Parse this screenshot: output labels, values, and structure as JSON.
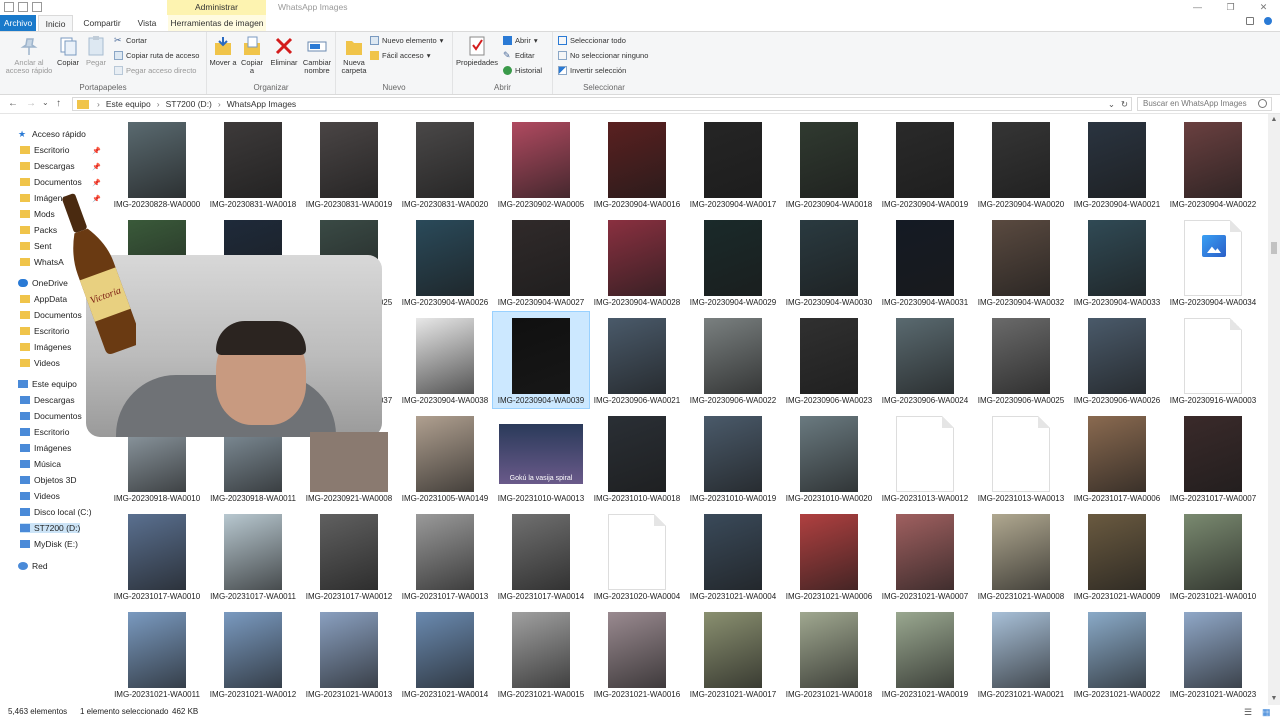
{
  "window": {
    "context_tab": "Administrar",
    "title": "WhatsApp Images"
  },
  "tabs": {
    "archivo": "Archivo",
    "inicio": "Inicio",
    "compartir": "Compartir",
    "vista": "Vista",
    "herramientas": "Herramientas de imagen"
  },
  "ribbon": {
    "portapapeles": {
      "label": "Portapapeles",
      "anclar": "Anclar al acceso rápido",
      "copiar": "Copiar",
      "pegar": "Pegar",
      "cortar": "Cortar",
      "copiar_ruta": "Copiar ruta de acceso",
      "pegar_acceso": "Pegar acceso directo"
    },
    "organizar": {
      "label": "Organizar",
      "mover": "Mover a",
      "copiar": "Copiar a",
      "eliminar": "Eliminar",
      "cambiar": "Cambiar nombre"
    },
    "nuevo": {
      "label": "Nuevo",
      "nueva_carpeta": "Nueva carpeta",
      "nuevo_elemento": "Nuevo elemento",
      "facil_acceso": "Fácil acceso"
    },
    "abrir": {
      "label": "Abrir",
      "propiedades": "Propiedades",
      "abrir": "Abrir",
      "editar": "Editar",
      "historial": "Historial"
    },
    "seleccionar": {
      "label": "Seleccionar",
      "todo": "Seleccionar todo",
      "ninguno": "No seleccionar ninguno",
      "invertir": "Invertir selección"
    }
  },
  "address": {
    "crumbs": [
      "Este equipo",
      "ST7200 (D:)",
      "WhatsApp Images"
    ],
    "search_placeholder": "Buscar en WhatsApp Images"
  },
  "navpane": {
    "quick_access": "Acceso rápido",
    "quick_items": [
      "Escritorio",
      "Descargas",
      "Documentos",
      "Imágenes",
      "Mods",
      "Packs",
      "Sent",
      "WhatsA"
    ],
    "onedrive": "OneDrive",
    "onedrive_items": [
      "AppData",
      "Documentos",
      "Escritorio",
      "Imágenes",
      "Videos"
    ],
    "this_pc": "Este equipo",
    "pc_items": [
      "Descargas",
      "Documentos",
      "Escritorio",
      "Imágenes",
      "Música",
      "Objetos 3D",
      "Videos",
      "Disco local (C:)",
      "ST7200 (D:)",
      "MyDisk (E:)"
    ],
    "network": "Red"
  },
  "files": [
    [
      "IMG-20230828-WA0000",
      "IMG-20230831-WA0018",
      "IMG-20230831-WA0019",
      "IMG-20230831-WA0020",
      "IMG-20230902-WA0005",
      "IMG-20230904-WA0016",
      "IMG-20230904-WA0017",
      "IMG-20230904-WA0018",
      "IMG-20230904-WA0019",
      "IMG-20230904-WA0020",
      "IMG-20230904-WA0021",
      "IMG-20230904-WA0022"
    ],
    [
      "",
      "",
      "IMG-20230904-WA0025",
      "IMG-20230904-WA0026",
      "IMG-20230904-WA0027",
      "IMG-20230904-WA0028",
      "IMG-20230904-WA0029",
      "IMG-20230904-WA0030",
      "IMG-20230904-WA0031",
      "IMG-20230904-WA0032",
      "IMG-20230904-WA0033",
      "IMG-20230904-WA0034"
    ],
    [
      "",
      "",
      "IMG-20230904-WA0037",
      "IMG-20230904-WA0038",
      "IMG-20230904-WA0039",
      "IMG-20230906-WA0021",
      "IMG-20230906-WA0022",
      "IMG-20230906-WA0023",
      "IMG-20230906-WA0024",
      "IMG-20230906-WA0025",
      "IMG-20230906-WA0026",
      "IMG-20230916-WA0003"
    ],
    [
      "IMG-20230918-WA0010",
      "IMG-20230918-WA0011",
      "IMG-20230921-WA0008",
      "IMG-20231005-WA0149",
      "IMG-20231010-WA0013",
      "IMG-20231010-WA0018",
      "IMG-20231010-WA0019",
      "IMG-20231010-WA0020",
      "IMG-20231013-WA0012",
      "IMG-20231013-WA0013",
      "IMG-20231017-WA0006",
      "IMG-20231017-WA0007"
    ],
    [
      "IMG-20231017-WA0010",
      "IMG-20231017-WA0011",
      "IMG-20231017-WA0012",
      "IMG-20231017-WA0013",
      "IMG-20231017-WA0014",
      "IMG-20231020-WA0004",
      "IMG-20231021-WA0004",
      "IMG-20231021-WA0006",
      "IMG-20231021-WA0007",
      "IMG-20231021-WA0008",
      "IMG-20231021-WA0009",
      "IMG-20231021-WA0010"
    ],
    [
      "IMG-20231021-WA0011",
      "IMG-20231021-WA0012",
      "IMG-20231021-WA0013",
      "IMG-20231021-WA0014",
      "IMG-20231021-WA0015",
      "IMG-20231021-WA0016",
      "IMG-20231021-WA0017",
      "IMG-20231021-WA0018",
      "IMG-20231021-WA0019",
      "IMG-20231021-WA0021",
      "IMG-20231021-WA0022",
      "IMG-20231021-WA0023"
    ]
  ],
  "thumb_colors": [
    [
      "#5a6a70",
      "#3d3a3a",
      "#4a4545",
      "#4a4848",
      "#b04a60",
      "#5a2020",
      "#252525",
      "#303a30",
      "#2a2a2a",
      "#353535",
      "#2a3440",
      "#6a4040"
    ],
    [
      "#3a5a3a",
      "#1e2a3a",
      "#3a4a45",
      "#2a4a5a",
      "#302a2a",
      "#8a3040",
      "#1a2a2a",
      "#2a3a40",
      "#141a24",
      "#5a4a40",
      "#304a55",
      "doc-icon"
    ],
    [
      "#000000",
      "#000000",
      "#2a2a2a",
      "#e8e8e8",
      "#101010",
      "#4a5a6a",
      "#7a8080",
      "#303030",
      "#5a6a70",
      "#6a6a6a",
      "#4a5a6a",
      "doc"
    ],
    [
      "#9aa7b0",
      "#8a9aa5",
      "#8a7a70",
      "#b0a090",
      "wide",
      "#2a2f35",
      "#4a5a6a",
      "#6a7a80",
      "doc",
      "doc",
      "#8a6a50",
      "#3a2a2a"
    ],
    [
      "#5a7090",
      "#b8c8d0",
      "#606060",
      "#9a9a9a",
      "#707070",
      "doc",
      "#3a4a5a",
      "#b04040",
      "#a06060",
      "#b0a890",
      "#6a5a40",
      "#7a8a70"
    ],
    [
      "#7a9ac0",
      "#7a9ac0",
      "#8aa0c0",
      "#6a8ab0",
      "#a0a0a0",
      "#9a8a90",
      "#8a9070",
      "#a0a890",
      "#9aa890",
      "#a8c0d8",
      "#8aaac8",
      "#90a8c8"
    ]
  ],
  "selected_file": "IMG-20230904-WA0039",
  "wide_thumb_caption": "Gokú la vasija spiral",
  "status": {
    "count": "5,463 elementos",
    "selected": "1 elemento seleccionado",
    "size": "462 KB"
  },
  "overlay": {
    "bottle_label": "Victoria"
  }
}
